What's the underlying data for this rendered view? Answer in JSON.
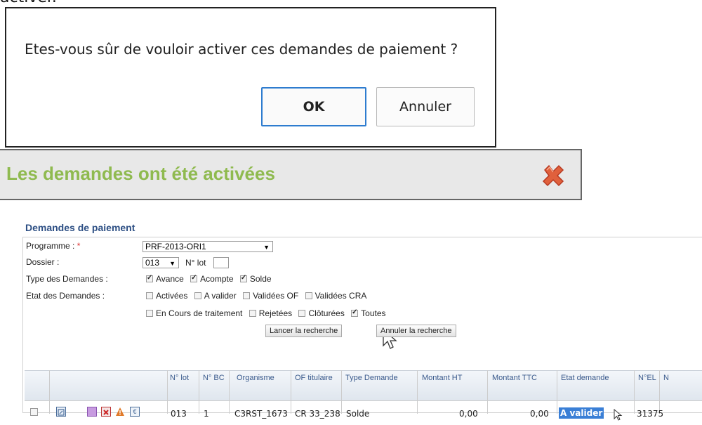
{
  "top_clipped_text": "activer.",
  "dialog": {
    "message": "Etes-vous sûr de vouloir activer ces demandes de paiement ?",
    "ok_label": "OK",
    "cancel_label": "Annuler"
  },
  "notification": {
    "message": "Les demandes ont été activées",
    "close_icon": "close-icon",
    "text_color": "#8fba4f"
  },
  "form": {
    "title": "Demandes de paiement",
    "programme_label": "Programme :",
    "required_marker": "*",
    "programme_value": "PRF-2013-ORI1",
    "dossier_label": "Dossier :",
    "dossier_value": "013",
    "lot_label": "N° lot",
    "lot_value": "",
    "type_label": "Type des Demandes :",
    "types": [
      {
        "label": "Avance",
        "checked": true
      },
      {
        "label": "Acompte",
        "checked": true
      },
      {
        "label": "Solde",
        "checked": true
      }
    ],
    "etat_label": "Etat des Demandes :",
    "etats_row1": [
      {
        "label": "Activées",
        "checked": false
      },
      {
        "label": "A valider",
        "checked": false
      },
      {
        "label": "Validées OF",
        "checked": false
      },
      {
        "label": "Validées CRA",
        "checked": false
      }
    ],
    "etats_row2": [
      {
        "label": "En Cours de traitement",
        "checked": false
      },
      {
        "label": "Rejetées",
        "checked": false
      },
      {
        "label": "Clôturées",
        "checked": false
      },
      {
        "label": "Toutes",
        "checked": true
      }
    ],
    "search_button": "Lancer la recherche",
    "cancel_search_button": "Annuler la recherche"
  },
  "table": {
    "headers": [
      "N° lot",
      "N° BC",
      "Organisme",
      "OF titulaire",
      "Type Demande",
      "Montant HT",
      "Montant TTC",
      "Etat demande",
      "N°EL",
      "N"
    ],
    "row": {
      "lot": "013",
      "bc": "1",
      "organisme": "C3RST_1673",
      "of_titulaire": "CR 33_238",
      "type": "Solde",
      "montant_ht": "0,00",
      "montant_ttc": "0,00",
      "etat": "A valider",
      "el": "31375",
      "etat_highlight": "#3a7fd6"
    }
  }
}
